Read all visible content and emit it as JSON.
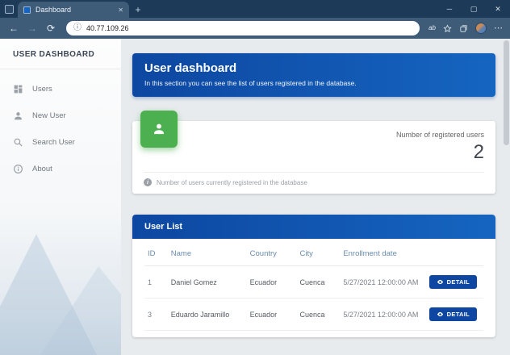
{
  "browser": {
    "tab_title": "Dashboard",
    "address": "40.77.109.26",
    "icons": {
      "back": "←",
      "forward": "→",
      "refresh": "⟳",
      "new_tab": "+",
      "tab_close": "✕",
      "minimize": "─",
      "maximize": "▢",
      "close": "✕",
      "more": "⋯",
      "page_info": "ⓘ",
      "read_aloud": "ab",
      "info_badge": "i"
    }
  },
  "sidebar": {
    "title": "USER DASHBOARD",
    "items": [
      {
        "label": "Users",
        "icon": "dashboard-grid-icon"
      },
      {
        "label": "New User",
        "icon": "person-icon"
      },
      {
        "label": "Search User",
        "icon": "search-icon"
      },
      {
        "label": "About",
        "icon": "info-icon"
      }
    ]
  },
  "banner": {
    "title": "User dashboard",
    "subtitle": "In this section you can see the list of users registered in the database."
  },
  "stats": {
    "label": "Number of registered users",
    "value": "2",
    "footnote": "Number of users currently registered in the database"
  },
  "user_list": {
    "title": "User List",
    "columns": [
      "ID",
      "Name",
      "Country",
      "City",
      "Enrollment date"
    ],
    "detail_label": "DETAIL",
    "rows": [
      {
        "id": "1",
        "name": "Daniel Gomez",
        "country": "Ecuador",
        "city": "Cuenca",
        "enrollment": "5/27/2021 12:00:00 AM"
      },
      {
        "id": "3",
        "name": "Eduardo Jaramillo",
        "country": "Ecuador",
        "city": "Cuenca",
        "enrollment": "5/27/2021 12:00:00 AM"
      }
    ]
  },
  "colors": {
    "titlebar": "#1d3a58",
    "toolbar": "#3e5c78",
    "brand_blue_dark": "#0d47a1",
    "brand_blue_light": "#1565c0",
    "stat_green": "#4caf50"
  }
}
